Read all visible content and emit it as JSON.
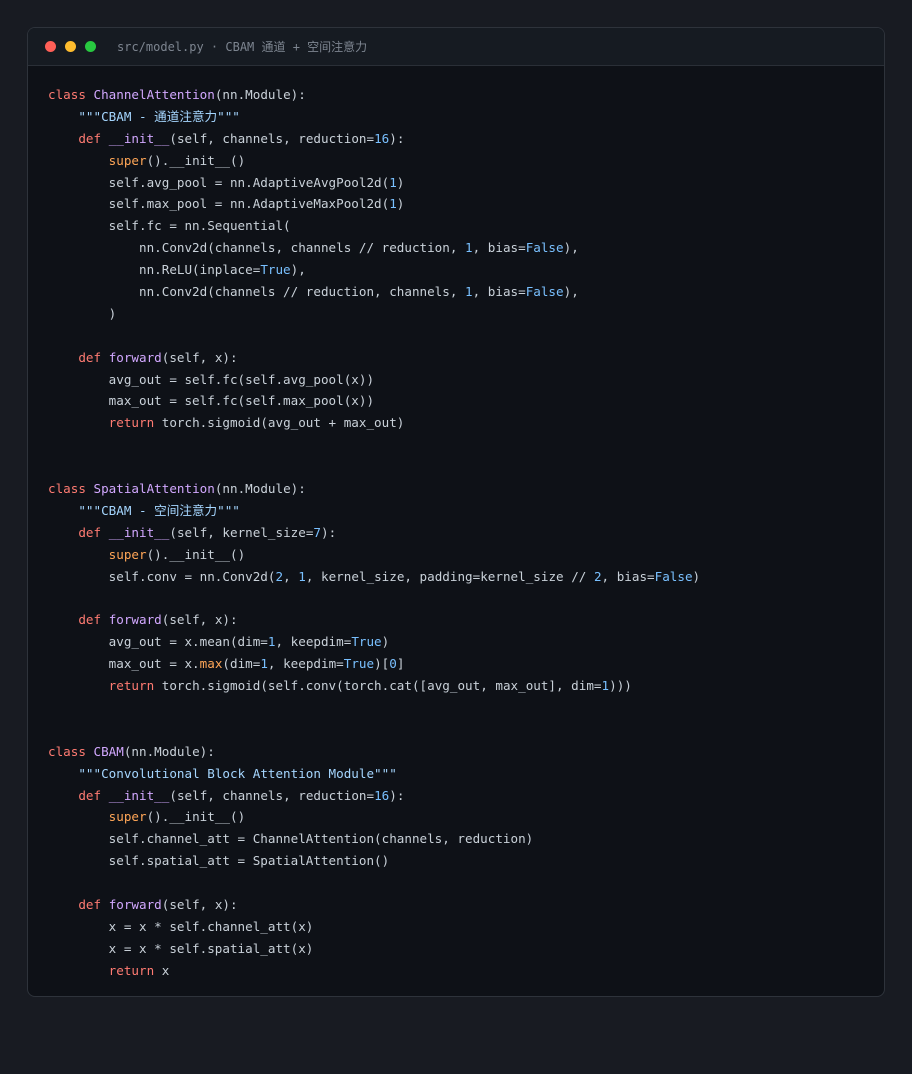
{
  "window": {
    "title": "src/model.py · CBAM 通道 + 空间注意力",
    "dots": {
      "close": "#ff5f57",
      "minimize": "#febc2e",
      "maximize": "#28c840"
    }
  },
  "colors": {
    "keyword": "#ff7b72",
    "definition": "#d2a8ff",
    "builtin": "#ffa657",
    "number": "#79c0ff",
    "string": "#a5d6ff",
    "text": "#c9d1d9"
  },
  "code_lines": [
    [
      [
        "kw",
        "class "
      ],
      [
        "def",
        "ChannelAttention"
      ],
      [
        "t",
        "(nn.Module):"
      ]
    ],
    [
      [
        "t",
        "    "
      ],
      [
        "str",
        "\"\"\"CBAM - 通道注意力\"\"\""
      ]
    ],
    [
      [
        "t",
        "    "
      ],
      [
        "kw",
        "def "
      ],
      [
        "def",
        "__init__"
      ],
      [
        "t",
        "(self, channels, reduction="
      ],
      [
        "num",
        "16"
      ],
      [
        "t",
        "):"
      ]
    ],
    [
      [
        "t",
        "        "
      ],
      [
        "bi",
        "super"
      ],
      [
        "t",
        "().__init__()"
      ]
    ],
    [
      [
        "t",
        "        self.avg_pool = nn.AdaptiveAvgPool2d("
      ],
      [
        "num",
        "1"
      ],
      [
        "t",
        ")"
      ]
    ],
    [
      [
        "t",
        "        self.max_pool = nn.AdaptiveMaxPool2d("
      ],
      [
        "num",
        "1"
      ],
      [
        "t",
        ")"
      ]
    ],
    [
      [
        "t",
        "        self.fc = nn.Sequential("
      ]
    ],
    [
      [
        "t",
        "            nn.Conv2d(channels, channels // reduction, "
      ],
      [
        "num",
        "1"
      ],
      [
        "t",
        ", bias="
      ],
      [
        "num",
        "False"
      ],
      [
        "t",
        "),"
      ]
    ],
    [
      [
        "t",
        "            nn.ReLU(inplace="
      ],
      [
        "num",
        "True"
      ],
      [
        "t",
        "),"
      ]
    ],
    [
      [
        "t",
        "            nn.Conv2d(channels // reduction, channels, "
      ],
      [
        "num",
        "1"
      ],
      [
        "t",
        ", bias="
      ],
      [
        "num",
        "False"
      ],
      [
        "t",
        "),"
      ]
    ],
    [
      [
        "t",
        "        )"
      ]
    ],
    [],
    [
      [
        "t",
        "    "
      ],
      [
        "kw",
        "def "
      ],
      [
        "def",
        "forward"
      ],
      [
        "t",
        "(self, x):"
      ]
    ],
    [
      [
        "t",
        "        avg_out = self.fc(self.avg_pool(x))"
      ]
    ],
    [
      [
        "t",
        "        max_out = self.fc(self.max_pool(x))"
      ]
    ],
    [
      [
        "t",
        "        "
      ],
      [
        "kw",
        "return "
      ],
      [
        "t",
        "torch.sigmoid(avg_out + max_out)"
      ]
    ],
    [],
    [],
    [
      [
        "kw",
        "class "
      ],
      [
        "def",
        "SpatialAttention"
      ],
      [
        "t",
        "(nn.Module):"
      ]
    ],
    [
      [
        "t",
        "    "
      ],
      [
        "str",
        "\"\"\"CBAM - 空间注意力\"\"\""
      ]
    ],
    [
      [
        "t",
        "    "
      ],
      [
        "kw",
        "def "
      ],
      [
        "def",
        "__init__"
      ],
      [
        "t",
        "(self, kernel_size="
      ],
      [
        "num",
        "7"
      ],
      [
        "t",
        "):"
      ]
    ],
    [
      [
        "t",
        "        "
      ],
      [
        "bi",
        "super"
      ],
      [
        "t",
        "().__init__()"
      ]
    ],
    [
      [
        "t",
        "        self.conv = nn.Conv2d("
      ],
      [
        "num",
        "2"
      ],
      [
        "t",
        ", "
      ],
      [
        "num",
        "1"
      ],
      [
        "t",
        ", kernel_size, padding=kernel_size // "
      ],
      [
        "num",
        "2"
      ],
      [
        "t",
        ", bias="
      ],
      [
        "num",
        "False"
      ],
      [
        "t",
        ")"
      ]
    ],
    [],
    [
      [
        "t",
        "    "
      ],
      [
        "kw",
        "def "
      ],
      [
        "def",
        "forward"
      ],
      [
        "t",
        "(self, x):"
      ]
    ],
    [
      [
        "t",
        "        avg_out = x.mean(dim="
      ],
      [
        "num",
        "1"
      ],
      [
        "t",
        ", keepdim="
      ],
      [
        "num",
        "True"
      ],
      [
        "t",
        ")"
      ]
    ],
    [
      [
        "t",
        "        max_out = x."
      ],
      [
        "bi",
        "max"
      ],
      [
        "t",
        "(dim="
      ],
      [
        "num",
        "1"
      ],
      [
        "t",
        ", keepdim="
      ],
      [
        "num",
        "True"
      ],
      [
        "t",
        ")["
      ],
      [
        "num",
        "0"
      ],
      [
        "t",
        "]"
      ]
    ],
    [
      [
        "t",
        "        "
      ],
      [
        "kw",
        "return "
      ],
      [
        "t",
        "torch.sigmoid(self.conv(torch.cat([avg_out, max_out], dim="
      ],
      [
        "num",
        "1"
      ],
      [
        "t",
        ")))"
      ]
    ],
    [],
    [],
    [
      [
        "kw",
        "class "
      ],
      [
        "def",
        "CBAM"
      ],
      [
        "t",
        "(nn.Module):"
      ]
    ],
    [
      [
        "t",
        "    "
      ],
      [
        "str",
        "\"\"\"Convolutional Block Attention Module\"\"\""
      ]
    ],
    [
      [
        "t",
        "    "
      ],
      [
        "kw",
        "def "
      ],
      [
        "def",
        "__init__"
      ],
      [
        "t",
        "(self, channels, reduction="
      ],
      [
        "num",
        "16"
      ],
      [
        "t",
        "):"
      ]
    ],
    [
      [
        "t",
        "        "
      ],
      [
        "bi",
        "super"
      ],
      [
        "t",
        "().__init__()"
      ]
    ],
    [
      [
        "t",
        "        self.channel_att = ChannelAttention(channels, reduction)"
      ]
    ],
    [
      [
        "t",
        "        self.spatial_att = SpatialAttention()"
      ]
    ],
    [],
    [
      [
        "t",
        "    "
      ],
      [
        "kw",
        "def "
      ],
      [
        "def",
        "forward"
      ],
      [
        "t",
        "(self, x):"
      ]
    ],
    [
      [
        "t",
        "        x = x * self.channel_att(x)"
      ]
    ],
    [
      [
        "t",
        "        x = x * self.spatial_att(x)"
      ]
    ],
    [
      [
        "t",
        "        "
      ],
      [
        "kw",
        "return "
      ],
      [
        "t",
        "x"
      ]
    ]
  ]
}
